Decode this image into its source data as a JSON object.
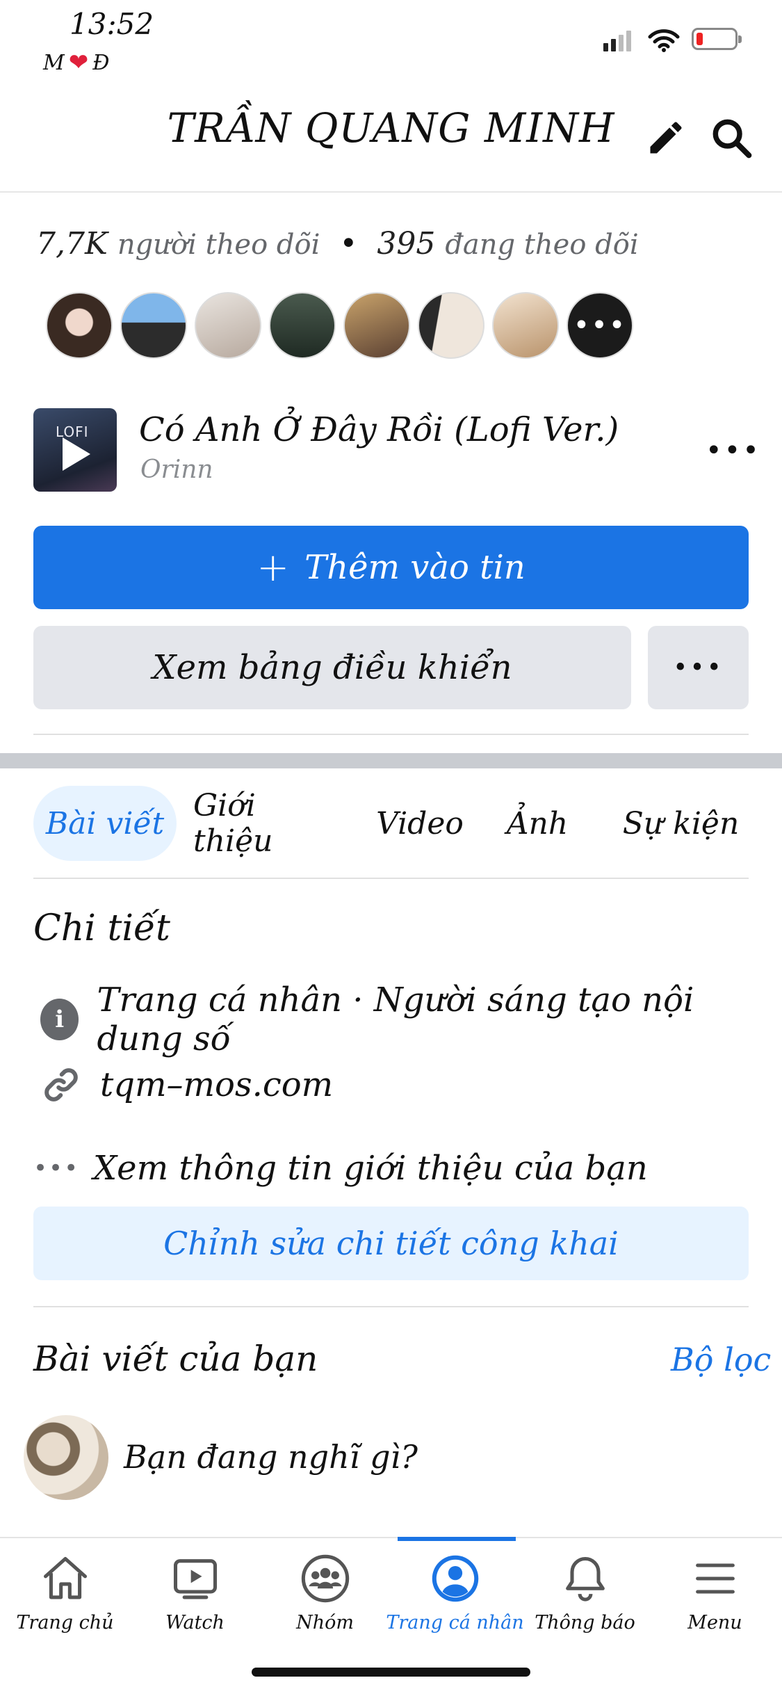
{
  "status_bar": {
    "time": "13:52",
    "sub_left": "M",
    "sub_right": "Đ"
  },
  "header": {
    "title": "TRẦN QUANG MINH",
    "icons": [
      "pencil-icon",
      "search-icon"
    ]
  },
  "stats": {
    "followers_count": "7,7K",
    "followers_label": "người theo dõi",
    "separator": "•",
    "following_count": "395",
    "following_label": "đang theo dõi"
  },
  "music": {
    "thumb_label": "LOFI",
    "title": "Có Anh Ở Đây Rồi (Lofi Ver.)",
    "artist": "Orinn"
  },
  "actions": {
    "add_story": "Thêm vào tin",
    "add_story_icon": "+",
    "dashboard": "Xem bảng điều khiển",
    "more": "•••"
  },
  "tabs": [
    "Bài viết",
    "Giới thiệu",
    "Video",
    "Ảnh",
    "Sự kiện"
  ],
  "details": {
    "title": "Chi tiết",
    "profile_type": "Trang cá nhân · Người sáng tạo nội dung số",
    "website": "tqm–mos.com",
    "see_about": "Xem thông tin giới thiệu của bạn",
    "edit_button": "Chỉnh sửa chi tiết công khai"
  },
  "posts": {
    "title": "Bài viết của bạn",
    "filter": "Bộ lọc",
    "composer_placeholder": "Bạn đang nghĩ gì?"
  },
  "bottom_nav": [
    {
      "label": "Trang chủ",
      "icon": "home-icon"
    },
    {
      "label": "Watch",
      "icon": "video-icon"
    },
    {
      "label": "Nhóm",
      "icon": "groups-icon"
    },
    {
      "label": "Trang cá nhân",
      "icon": "profile-icon",
      "active": true
    },
    {
      "label": "Thông báo",
      "icon": "bell-icon"
    },
    {
      "label": "Menu",
      "icon": "menu-icon"
    }
  ],
  "colors": {
    "primary": "#1b74e4",
    "light_blue": "#e7f3ff",
    "grey_button": "#e4e6eb",
    "separator_band": "#c9ccd1"
  }
}
